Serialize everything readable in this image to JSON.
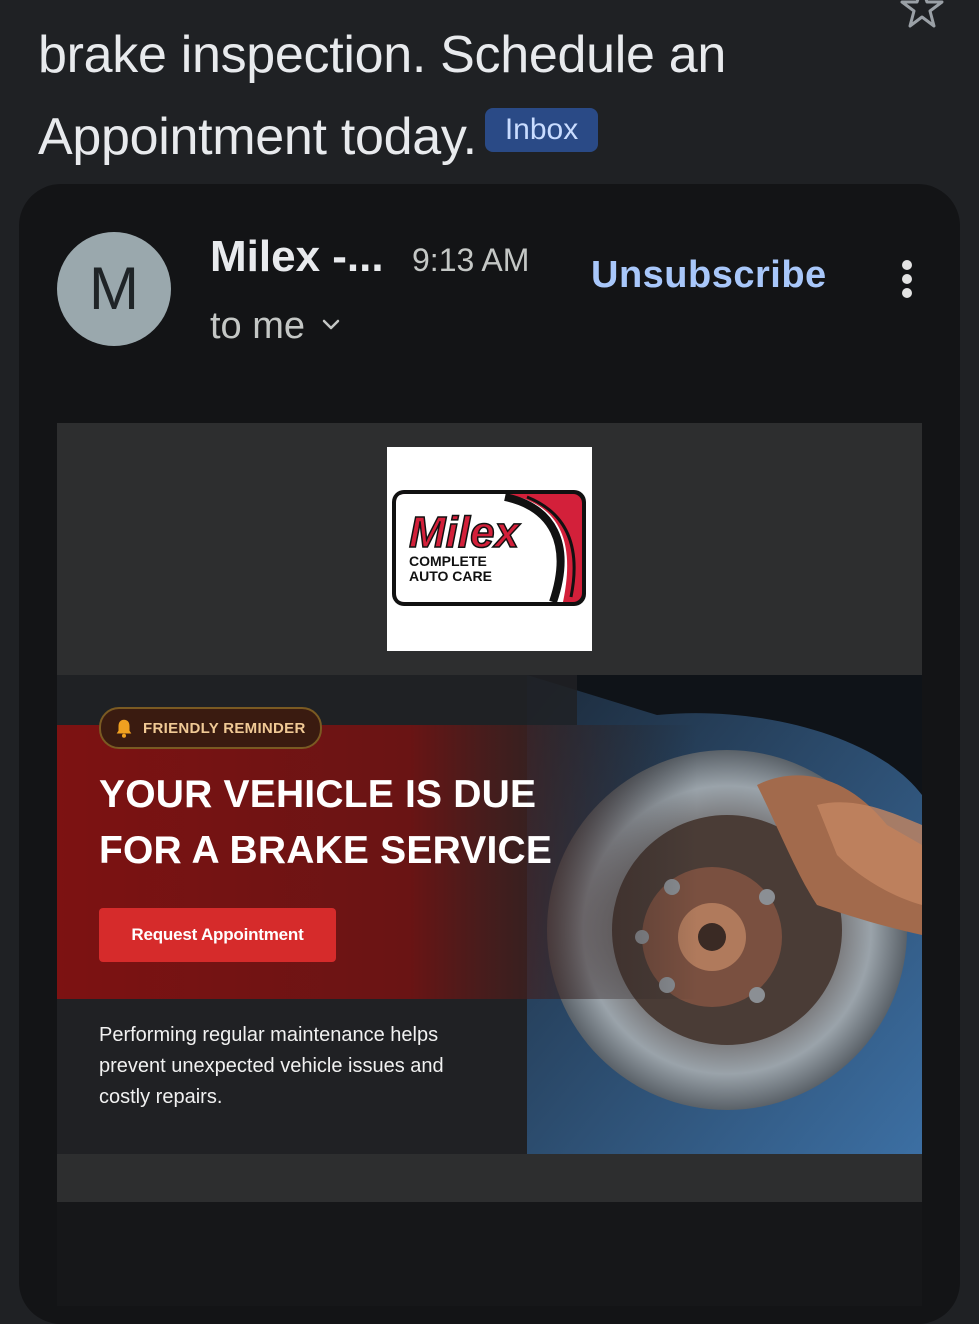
{
  "subject": {
    "text": "brake inspection. Schedule an Appointment today.",
    "label": "Inbox"
  },
  "message": {
    "avatar_letter": "M",
    "sender": "Milex -...",
    "time": "9:13 AM",
    "recipient": "to me",
    "unsubscribe": "Unsubscribe"
  },
  "email": {
    "logo": {
      "brand": "Milex",
      "line1": "COMPLETE",
      "line2": "AUTO CARE"
    },
    "reminder": "FRIENDLY REMINDER",
    "headline_line1": "YOUR VEHICLE IS DUE",
    "headline_line2": "FOR A BRAKE SERVICE",
    "cta": "Request Appointment",
    "body": "Performing regular maintenance helps prevent unexpected vehicle issues and costly repairs."
  },
  "icons": {
    "star": "star-outline-icon",
    "more": "more-vertical-icon",
    "chevron": "chevron-down-icon",
    "bell": "bell-icon"
  },
  "colors": {
    "background": "#1f2124",
    "card": "#131416",
    "label_chip": "#2a4a86",
    "unsubscribe": "#a8c7fa",
    "cta": "#d62b2b",
    "brand_red": "#d3203a"
  }
}
